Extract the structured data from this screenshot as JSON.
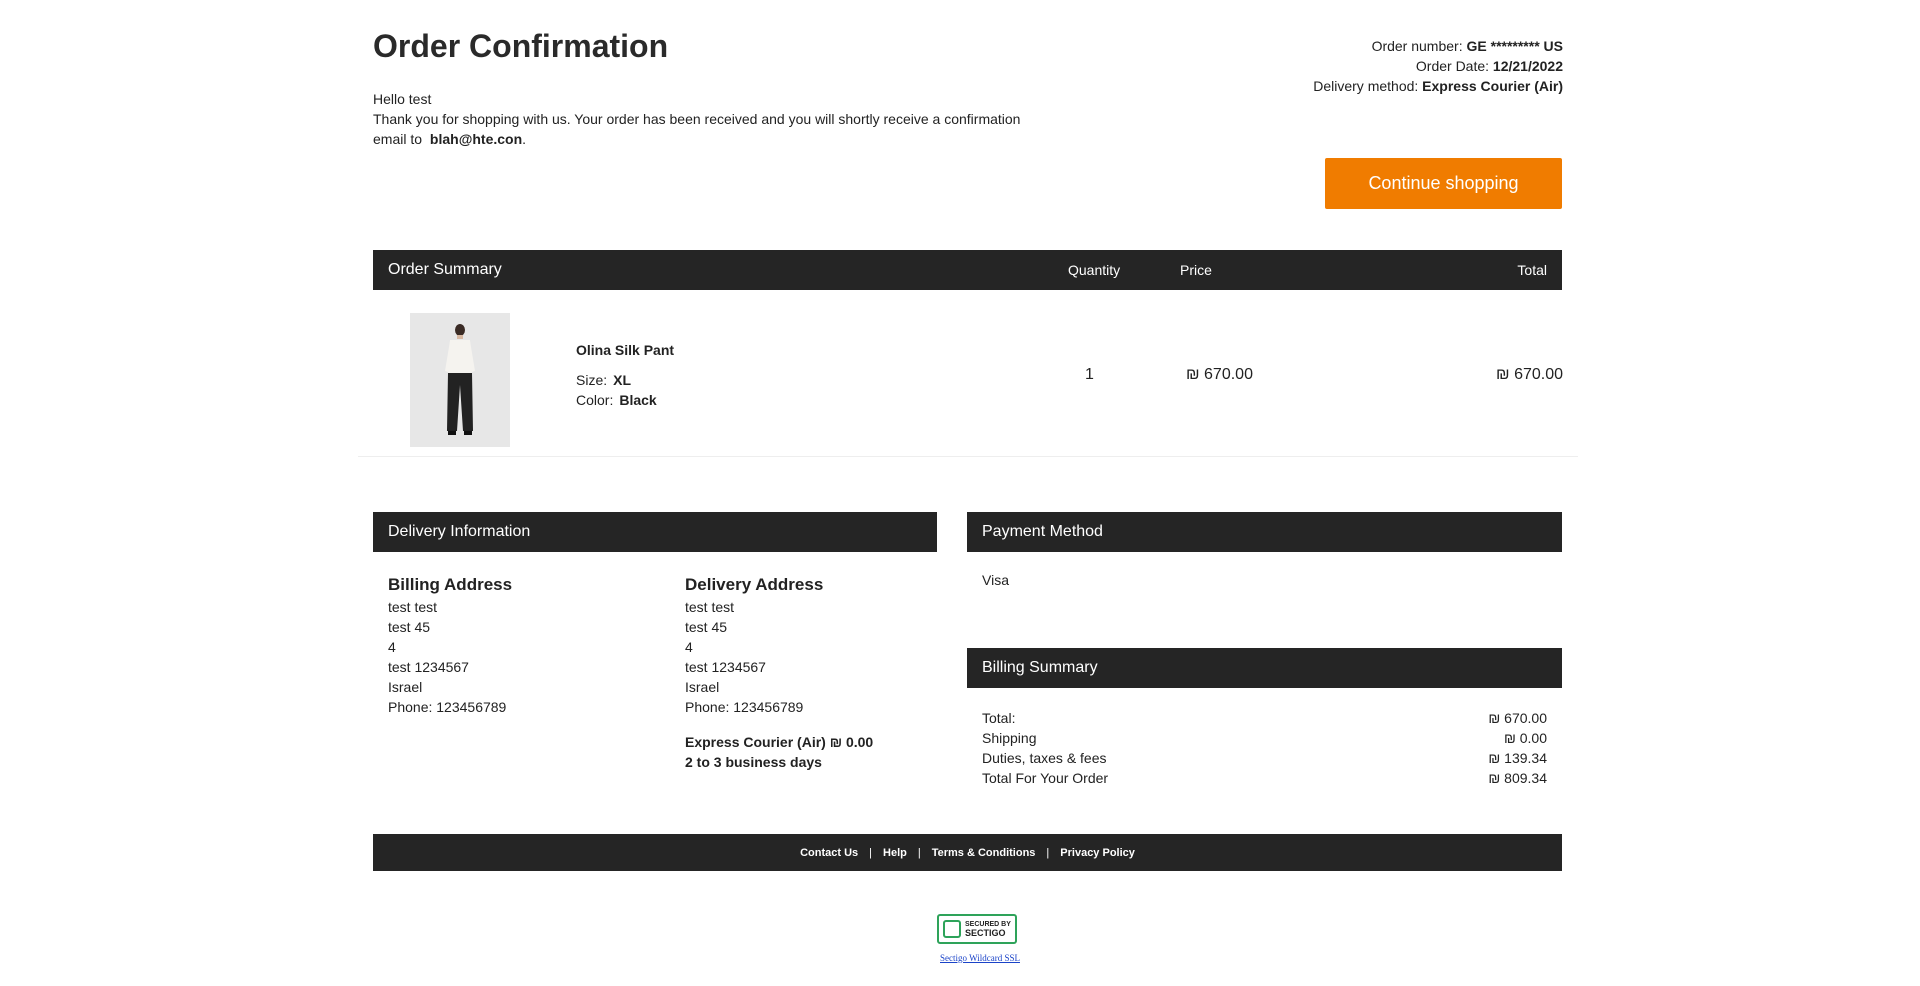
{
  "header": {
    "title": "Order Confirmation",
    "greeting": "Hello test",
    "message": "Thank you for shopping with us. Your order has been received and you will shortly receive a confirmation email to",
    "email": "blah@hte.con",
    "message_end": "."
  },
  "order_meta": {
    "order_number_label": "Order number:",
    "order_number": "GE ********* US",
    "order_date_label": "Order Date:",
    "order_date": "12/21/2022",
    "delivery_method_label": "Delivery method:",
    "delivery_method": "Express Courier (Air)"
  },
  "continue_button": "Continue shopping",
  "summary": {
    "title": "Order Summary",
    "col_quantity": "Quantity",
    "col_price": "Price",
    "col_total": "Total",
    "items": [
      {
        "name": "Olina Silk Pant",
        "size_label": "Size:",
        "size": "XL",
        "color_label": "Color:",
        "color": "Black",
        "quantity": "1",
        "price": "₪ 670.00",
        "total": "₪ 670.00"
      }
    ]
  },
  "delivery": {
    "title": "Delivery Information",
    "billing": {
      "title": "Billing Address",
      "name": "test test",
      "street": "test 45",
      "line3": "4",
      "city": "test 1234567",
      "country": "Israel",
      "phone": "Phone: 123456789"
    },
    "shipping": {
      "title": "Delivery Address",
      "name": "test test",
      "street": "test 45",
      "line3": "4",
      "city": "test 1234567",
      "country": "Israel",
      "phone": "Phone: 123456789"
    },
    "method_line": "Express Courier (Air) ₪ 0.00",
    "eta": "2 to 3 business days"
  },
  "payment": {
    "title": "Payment Method",
    "method": "Visa"
  },
  "billing_summary": {
    "title": "Billing Summary",
    "rows": [
      {
        "label": "Total:",
        "value": "₪ 670.00"
      },
      {
        "label": "Shipping",
        "value": "₪ 0.00"
      },
      {
        "label": "Duties, taxes & fees",
        "value": "₪ 139.34"
      },
      {
        "label": "Total For Your Order",
        "value": "₪ 809.34"
      }
    ]
  },
  "footer": {
    "links": [
      "Contact Us",
      "Help",
      "Terms & Conditions",
      "Privacy Policy"
    ],
    "separator": "|"
  },
  "seal": {
    "line1": "SECURED BY",
    "line2": "SECTIGO",
    "link": "Sectigo Wildcard SSL"
  },
  "colors": {
    "accent": "#f07c00",
    "bar": "#252525",
    "seal": "#2ea35a"
  }
}
